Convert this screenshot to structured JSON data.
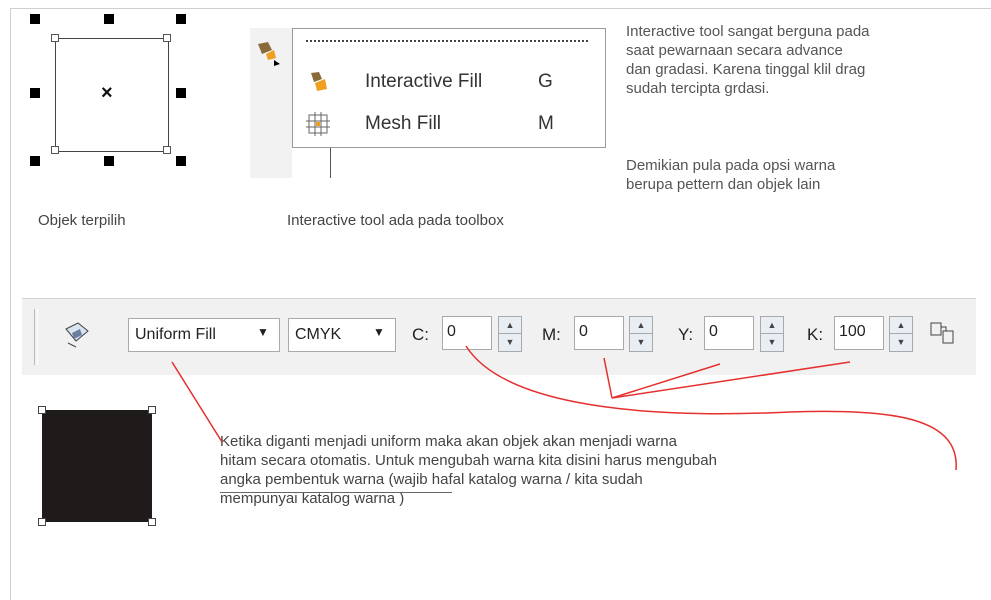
{
  "top": {
    "selected_caption": "Objek terpilih",
    "toolbox_caption": "Interactive tool ada pada toolbox",
    "menu": [
      {
        "label": "Interactive Fill",
        "key": "G",
        "icon": "interactive-fill-icon"
      },
      {
        "label": "Mesh Fill",
        "key": "M",
        "icon": "mesh-fill-icon"
      }
    ],
    "desc_lines": [
      "Interactive tool sangat berguna pada",
      "saat pewarnaan secara advance",
      "dan gradasi. Karena tinggal klil drag",
      "sudah tercipta grdasi."
    ],
    "desc2_lines": [
      "Demikian pula pada opsi warna",
      "berupa pettern dan objek lain"
    ]
  },
  "propbar": {
    "fill_type": "Uniform Fill",
    "color_model": "CMYK",
    "c_label": "C:",
    "c_value": "0",
    "m_label": "M:",
    "m_value": "0",
    "y_label": "Y:",
    "y_value": "0",
    "k_label": "K:",
    "k_value": "100"
  },
  "bottom": {
    "line1": "Ketika diganti menjadi uniform maka akan objek akan menjadi  warna",
    "line2": "hitam secara otomatis. Untuk mengubah warna kita disini harus mengubah",
    "line3_underlined": "angka pembentuk warna",
    "line3_rest": " (wajib hafal katalog warna / kita sudah",
    "line4": "mempunyai katalog warna )"
  },
  "colors": {
    "annotation_red": "#e53030",
    "selected_fill": "#1e1b1a"
  }
}
